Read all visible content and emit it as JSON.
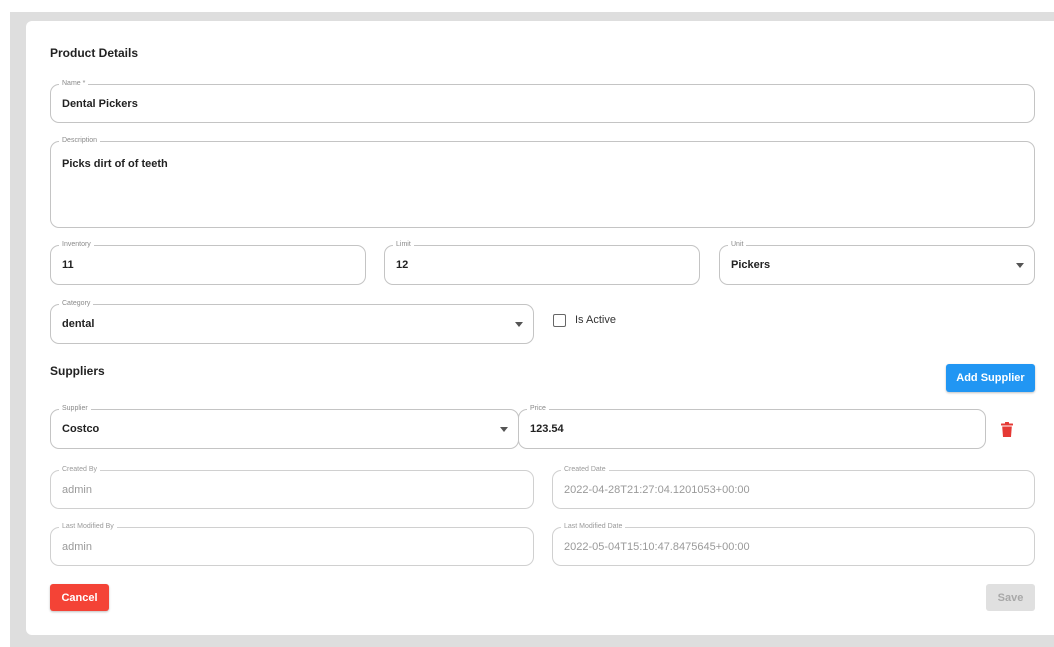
{
  "product_details": {
    "title": "Product Details",
    "name": {
      "label": "Name *",
      "value": "Dental Pickers"
    },
    "description": {
      "label": "Description",
      "value": "Picks dirt of of teeth"
    },
    "inventory": {
      "label": "Inventory",
      "value": "11"
    },
    "limit": {
      "label": "Limit",
      "value": "12"
    },
    "unit": {
      "label": "Unit",
      "value": "Pickers"
    },
    "category": {
      "label": "Category",
      "value": "dental"
    },
    "is_active": {
      "label": "Is Active",
      "checked": false
    }
  },
  "suppliers": {
    "title": "Suppliers",
    "add_label": "Add Supplier",
    "items": [
      {
        "supplier": {
          "label": "Supplier",
          "value": "Costco"
        },
        "price": {
          "label": "Price",
          "value": "123.54"
        }
      }
    ]
  },
  "audit": {
    "created_by": {
      "label": "Created By",
      "value": "admin"
    },
    "created_date": {
      "label": "Created Date",
      "value": "2022-04-28T21:27:04.1201053+00:00"
    },
    "last_modified_by": {
      "label": "Last Modified By",
      "value": "admin"
    },
    "last_modified_date": {
      "label": "Last Modified Date",
      "value": "2022-05-04T15:10:47.8475645+00:00"
    }
  },
  "actions": {
    "cancel_label": "Cancel",
    "save_label": "Save"
  },
  "colors": {
    "primary": "#2196f3",
    "danger": "#f44336",
    "disabled": "#e0e0e0"
  },
  "icons": {
    "delete": "trash-icon",
    "dropdown": "chevron-down-icon"
  }
}
